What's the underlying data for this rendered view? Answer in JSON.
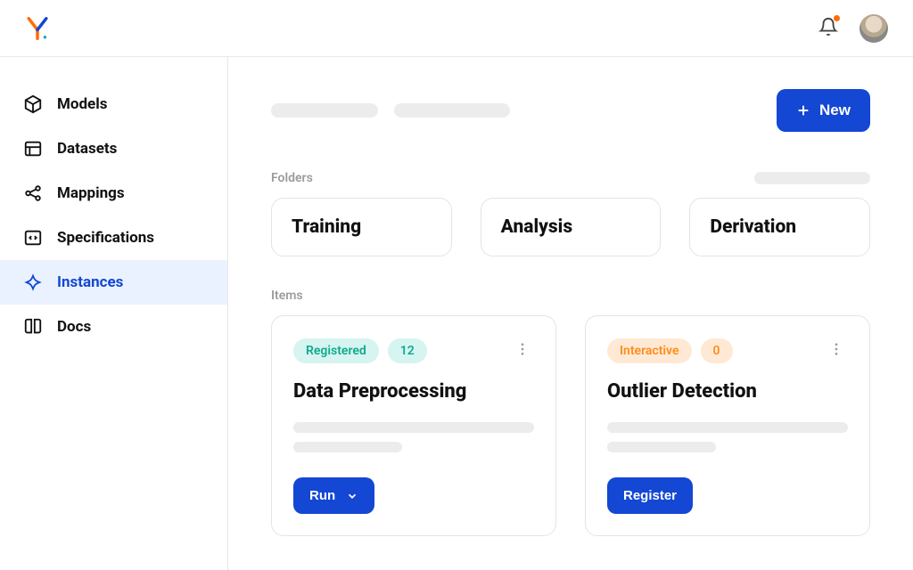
{
  "header": {
    "new_label": "New"
  },
  "sidebar": {
    "items": [
      {
        "label": "Models"
      },
      {
        "label": "Datasets"
      },
      {
        "label": "Mappings"
      },
      {
        "label": "Specifications"
      },
      {
        "label": "Instances"
      },
      {
        "label": "Docs"
      }
    ]
  },
  "sections": {
    "folders_label": "Folders",
    "items_label": "Items"
  },
  "folders": [
    {
      "name": "Training"
    },
    {
      "name": "Analysis"
    },
    {
      "name": "Derivation"
    }
  ],
  "items": [
    {
      "status": "Registered",
      "status_style": "teal",
      "count": "12",
      "title": "Data Preprocessing",
      "action_label": "Run",
      "action_has_chevron": true
    },
    {
      "status": "Interactive",
      "status_style": "orange",
      "count": "0",
      "title": "Outlier Detection",
      "action_label": "Register",
      "action_has_chevron": false
    }
  ]
}
